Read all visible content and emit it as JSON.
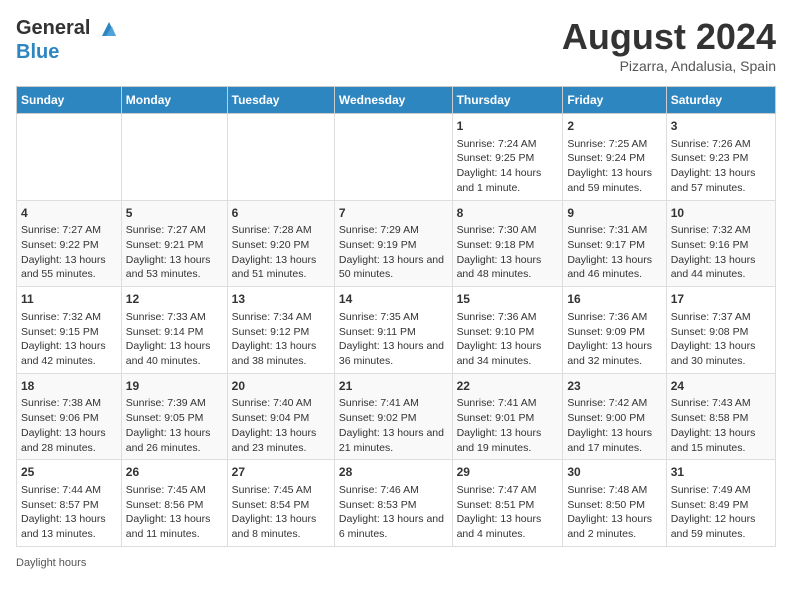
{
  "logo": {
    "line1": "General",
    "line2": "Blue"
  },
  "title": {
    "month_year": "August 2024",
    "location": "Pizarra, Andalusia, Spain"
  },
  "headers": [
    "Sunday",
    "Monday",
    "Tuesday",
    "Wednesday",
    "Thursday",
    "Friday",
    "Saturday"
  ],
  "weeks": [
    [
      {
        "day": "",
        "sunrise": "",
        "sunset": "",
        "daylight": ""
      },
      {
        "day": "",
        "sunrise": "",
        "sunset": "",
        "daylight": ""
      },
      {
        "day": "",
        "sunrise": "",
        "sunset": "",
        "daylight": ""
      },
      {
        "day": "",
        "sunrise": "",
        "sunset": "",
        "daylight": ""
      },
      {
        "day": "1",
        "sunrise": "Sunrise: 7:24 AM",
        "sunset": "Sunset: 9:25 PM",
        "daylight": "Daylight: 14 hours and 1 minute."
      },
      {
        "day": "2",
        "sunrise": "Sunrise: 7:25 AM",
        "sunset": "Sunset: 9:24 PM",
        "daylight": "Daylight: 13 hours and 59 minutes."
      },
      {
        "day": "3",
        "sunrise": "Sunrise: 7:26 AM",
        "sunset": "Sunset: 9:23 PM",
        "daylight": "Daylight: 13 hours and 57 minutes."
      }
    ],
    [
      {
        "day": "4",
        "sunrise": "Sunrise: 7:27 AM",
        "sunset": "Sunset: 9:22 PM",
        "daylight": "Daylight: 13 hours and 55 minutes."
      },
      {
        "day": "5",
        "sunrise": "Sunrise: 7:27 AM",
        "sunset": "Sunset: 9:21 PM",
        "daylight": "Daylight: 13 hours and 53 minutes."
      },
      {
        "day": "6",
        "sunrise": "Sunrise: 7:28 AM",
        "sunset": "Sunset: 9:20 PM",
        "daylight": "Daylight: 13 hours and 51 minutes."
      },
      {
        "day": "7",
        "sunrise": "Sunrise: 7:29 AM",
        "sunset": "Sunset: 9:19 PM",
        "daylight": "Daylight: 13 hours and 50 minutes."
      },
      {
        "day": "8",
        "sunrise": "Sunrise: 7:30 AM",
        "sunset": "Sunset: 9:18 PM",
        "daylight": "Daylight: 13 hours and 48 minutes."
      },
      {
        "day": "9",
        "sunrise": "Sunrise: 7:31 AM",
        "sunset": "Sunset: 9:17 PM",
        "daylight": "Daylight: 13 hours and 46 minutes."
      },
      {
        "day": "10",
        "sunrise": "Sunrise: 7:32 AM",
        "sunset": "Sunset: 9:16 PM",
        "daylight": "Daylight: 13 hours and 44 minutes."
      }
    ],
    [
      {
        "day": "11",
        "sunrise": "Sunrise: 7:32 AM",
        "sunset": "Sunset: 9:15 PM",
        "daylight": "Daylight: 13 hours and 42 minutes."
      },
      {
        "day": "12",
        "sunrise": "Sunrise: 7:33 AM",
        "sunset": "Sunset: 9:14 PM",
        "daylight": "Daylight: 13 hours and 40 minutes."
      },
      {
        "day": "13",
        "sunrise": "Sunrise: 7:34 AM",
        "sunset": "Sunset: 9:12 PM",
        "daylight": "Daylight: 13 hours and 38 minutes."
      },
      {
        "day": "14",
        "sunrise": "Sunrise: 7:35 AM",
        "sunset": "Sunset: 9:11 PM",
        "daylight": "Daylight: 13 hours and 36 minutes."
      },
      {
        "day": "15",
        "sunrise": "Sunrise: 7:36 AM",
        "sunset": "Sunset: 9:10 PM",
        "daylight": "Daylight: 13 hours and 34 minutes."
      },
      {
        "day": "16",
        "sunrise": "Sunrise: 7:36 AM",
        "sunset": "Sunset: 9:09 PM",
        "daylight": "Daylight: 13 hours and 32 minutes."
      },
      {
        "day": "17",
        "sunrise": "Sunrise: 7:37 AM",
        "sunset": "Sunset: 9:08 PM",
        "daylight": "Daylight: 13 hours and 30 minutes."
      }
    ],
    [
      {
        "day": "18",
        "sunrise": "Sunrise: 7:38 AM",
        "sunset": "Sunset: 9:06 PM",
        "daylight": "Daylight: 13 hours and 28 minutes."
      },
      {
        "day": "19",
        "sunrise": "Sunrise: 7:39 AM",
        "sunset": "Sunset: 9:05 PM",
        "daylight": "Daylight: 13 hours and 26 minutes."
      },
      {
        "day": "20",
        "sunrise": "Sunrise: 7:40 AM",
        "sunset": "Sunset: 9:04 PM",
        "daylight": "Daylight: 13 hours and 23 minutes."
      },
      {
        "day": "21",
        "sunrise": "Sunrise: 7:41 AM",
        "sunset": "Sunset: 9:02 PM",
        "daylight": "Daylight: 13 hours and 21 minutes."
      },
      {
        "day": "22",
        "sunrise": "Sunrise: 7:41 AM",
        "sunset": "Sunset: 9:01 PM",
        "daylight": "Daylight: 13 hours and 19 minutes."
      },
      {
        "day": "23",
        "sunrise": "Sunrise: 7:42 AM",
        "sunset": "Sunset: 9:00 PM",
        "daylight": "Daylight: 13 hours and 17 minutes."
      },
      {
        "day": "24",
        "sunrise": "Sunrise: 7:43 AM",
        "sunset": "Sunset: 8:58 PM",
        "daylight": "Daylight: 13 hours and 15 minutes."
      }
    ],
    [
      {
        "day": "25",
        "sunrise": "Sunrise: 7:44 AM",
        "sunset": "Sunset: 8:57 PM",
        "daylight": "Daylight: 13 hours and 13 minutes."
      },
      {
        "day": "26",
        "sunrise": "Sunrise: 7:45 AM",
        "sunset": "Sunset: 8:56 PM",
        "daylight": "Daylight: 13 hours and 11 minutes."
      },
      {
        "day": "27",
        "sunrise": "Sunrise: 7:45 AM",
        "sunset": "Sunset: 8:54 PM",
        "daylight": "Daylight: 13 hours and 8 minutes."
      },
      {
        "day": "28",
        "sunrise": "Sunrise: 7:46 AM",
        "sunset": "Sunset: 8:53 PM",
        "daylight": "Daylight: 13 hours and 6 minutes."
      },
      {
        "day": "29",
        "sunrise": "Sunrise: 7:47 AM",
        "sunset": "Sunset: 8:51 PM",
        "daylight": "Daylight: 13 hours and 4 minutes."
      },
      {
        "day": "30",
        "sunrise": "Sunrise: 7:48 AM",
        "sunset": "Sunset: 8:50 PM",
        "daylight": "Daylight: 13 hours and 2 minutes."
      },
      {
        "day": "31",
        "sunrise": "Sunrise: 7:49 AM",
        "sunset": "Sunset: 8:49 PM",
        "daylight": "Daylight: 12 hours and 59 minutes."
      }
    ]
  ],
  "footer": {
    "daylight_label": "Daylight hours"
  }
}
